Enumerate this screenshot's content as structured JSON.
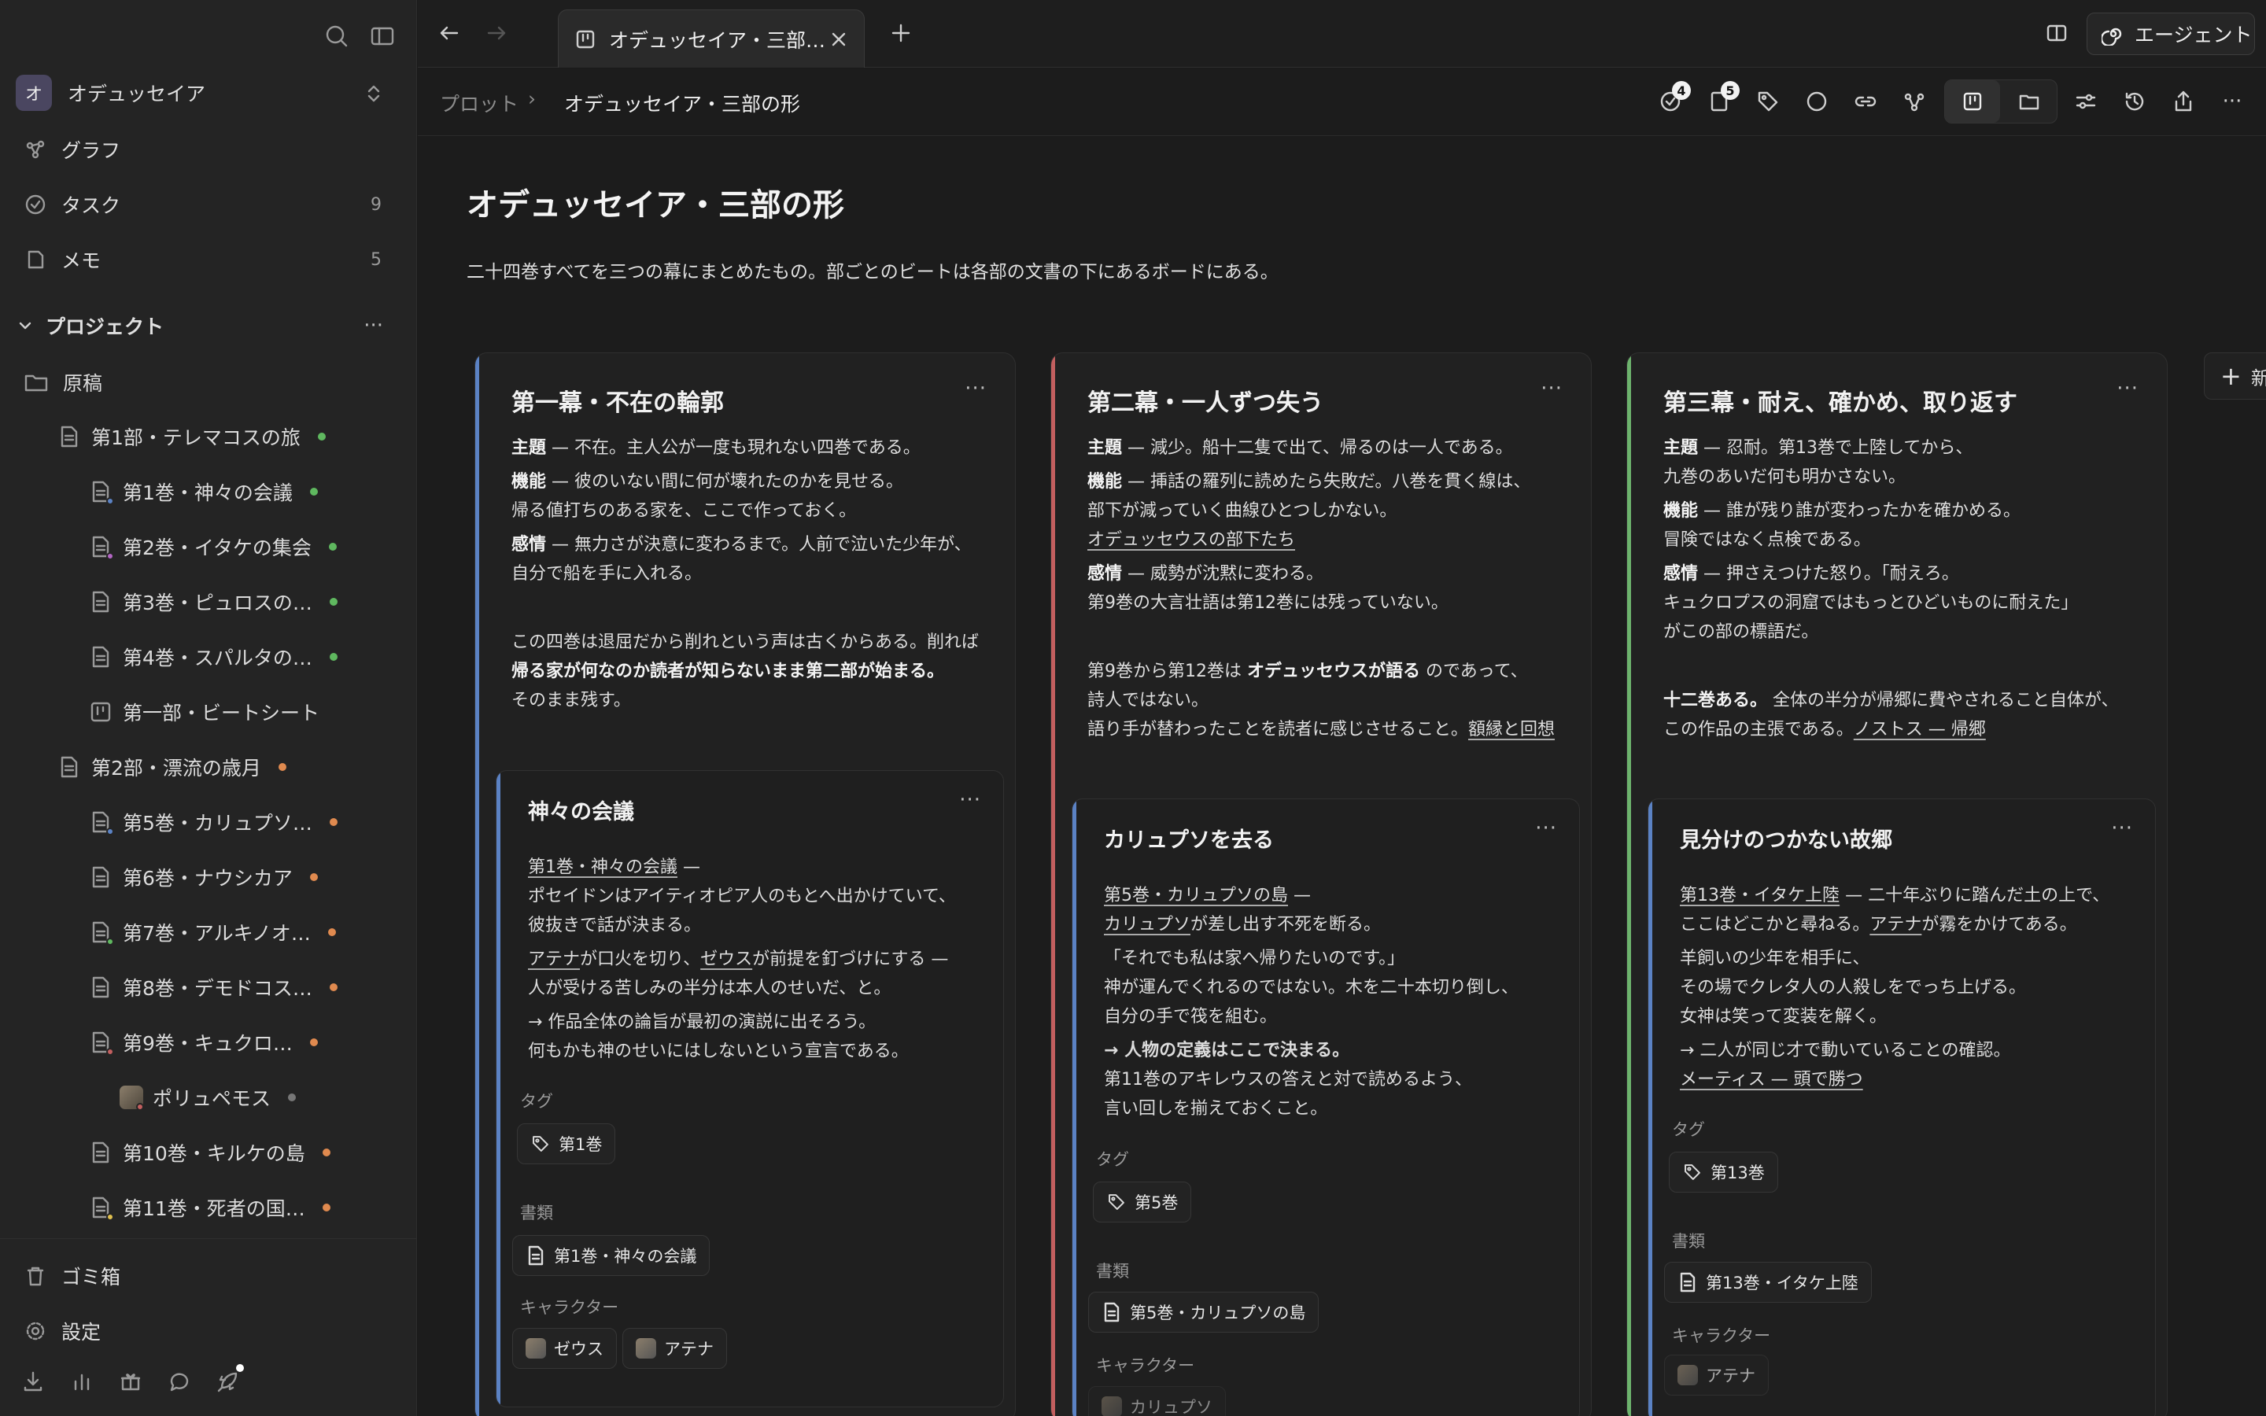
{
  "sidebar": {
    "workspace": {
      "initial": "オ",
      "name": "オデュッセイア"
    },
    "nav": [
      {
        "label": "グラフ",
        "count": ""
      },
      {
        "label": "タスク",
        "count": "9"
      },
      {
        "label": "メモ",
        "count": "5"
      }
    ],
    "projects_label": "プロジェクト",
    "tree": {
      "folder": "原稿",
      "items": [
        {
          "label": "第1部・テレマコスの旅"
        },
        {
          "label": "第1巻・神々の会議"
        },
        {
          "label": "第2巻・イタケの集会"
        },
        {
          "label": "第3巻・ピュロスの…"
        },
        {
          "label": "第4巻・スパルタの…"
        },
        {
          "label": "第一部・ビートシート"
        },
        {
          "label": "第2部・漂流の歳月"
        },
        {
          "label": "第5巻・カリュプソ…"
        },
        {
          "label": "第6巻・ナウシカア"
        },
        {
          "label": "第7巻・アルキノオ…"
        },
        {
          "label": "第8巻・デモドコス…"
        },
        {
          "label": "第9巻・キュクロ…"
        },
        {
          "label": "ポリュペモス"
        },
        {
          "label": "第10巻・キルケの島"
        },
        {
          "label": "第11巻・死者の国…"
        }
      ]
    },
    "trash": "ゴミ箱",
    "settings": "設定"
  },
  "topbar": {
    "tab_title": "オデュッセイア・三部の形",
    "agent_label": "エージェント"
  },
  "breadcrumb": {
    "parent": "プロット",
    "current": "オデュッセイア・三部の形"
  },
  "badges": {
    "tasks": "4",
    "docs": "5"
  },
  "page": {
    "title": "オデュッセイア・三部の形",
    "description": "二十四巻すべてを三つの幕にまとめたもの。部ごとのビートは各部の文書の下にあるボードにある。",
    "add_column_label": "新"
  },
  "colors": {
    "act1": "#5b82c4",
    "act2": "#c25f5f",
    "act3": "#6db36d"
  },
  "columns": [
    {
      "title": "第一幕・不在の輪郭",
      "l1": "主題",
      "l1t": " — 不在。主人公が一度も現れない四巻である。",
      "l2": "機能",
      "l2t": " — 彼のいない間に何が壊れたのかを見せる。",
      "l2b": "帰る値打ちのある家を、ここで作っておく。",
      "l3": "感情",
      "l3t": " — 無力さが決意に変わるまで。人前で泣いた少年が、",
      "l3b": "自分で船を手に入れる。",
      "p1": "この四巻は退屈だから削れという声は古くからある。削れば",
      "p2": "帰る家が何なのか読者が知らないまま第二部が始まる。",
      "p3": "そのまま残す。",
      "card": {
        "title": "神々の会議",
        "link1": "第1巻・神々の会議",
        "dash": " —",
        "t1": "ポセイドンはアイティオピア人のもとへ出かけていて、",
        "t2": "彼抜きで話が決まる。",
        "link2": "アテナ",
        "t3": "が口火を切り、",
        "link3": "ゼウス",
        "t4": "が前提を釘づけにする —",
        "t5": "人が受ける苦しみの半分は本人のせいだ、と。",
        "t6": "→ 作品全体の論旨が最初の演説に出そろう。",
        "t7": "何もかも神のせいにはしないという宣言である。",
        "tag_label": "タグ",
        "tag": "第1巻",
        "doc_label": "書類",
        "doc": "第1巻・神々の会議",
        "char_label": "キャラクター",
        "chars": [
          "ゼウス",
          "アテナ"
        ]
      }
    },
    {
      "title": "第二幕・一人ずつ失う",
      "l1": "主題",
      "l1t": " — 減少。船十二隻で出て、帰るのは一人である。",
      "l2": "機能",
      "l2t": " — 挿話の羅列に読めたら失敗だ。八巻を貫く線は、",
      "l2b": "部下が減っていく曲線ひとつしかない。",
      "l2c": "オデュッセウスの部下たち",
      "l3": "感情",
      "l3t": " — 威勢が沈黙に変わる。",
      "l3b": "第9巻の大言壮語は第12巻には残っていない。",
      "p1a": "第9巻から第12巻は ",
      "p1b": "オデュッセウスが語る",
      "p1c": " のであって、",
      "p2": "詩人ではない。",
      "p3": "語り手が替わったことを読者に感じさせること。",
      "p3link": "額縁と回想",
      "card": {
        "title": "カリュプソを去る",
        "link1": "第5巻・カリュプソの島",
        "dash": " —",
        "link2": "カリュプソ",
        "t1": "が差し出す不死を断る。",
        "t2": "「それでも私は家へ帰りたいのです。」",
        "t3": "神が運んでくれるのではない。木を二十本切り倒し、",
        "t4": "自分の手で筏を組む。",
        "t5": "→ 人物の定義はここで決まる。",
        "t6": "第11巻のアキレウスの答えと対で読めるよう、",
        "t7": "言い回しを揃えておくこと。",
        "tag_label": "タグ",
        "tag": "第5巻",
        "doc_label": "書類",
        "doc": "第5巻・カリュプソの島",
        "char_label": "キャラクター",
        "chars": [
          "カリュプソ"
        ]
      }
    },
    {
      "title": "第三幕・耐え、確かめ、取り返す",
      "l1": "主題",
      "l1t": " — 忍耐。第13巻で上陸してから、",
      "l1b": "九巻のあいだ何も明かさない。",
      "l2": "機能",
      "l2t": " — 誰が残り誰が変わったかを確かめる。",
      "l2b": "冒険ではなく点検である。",
      "l3": "感情",
      "l3t": " — 押さえつけた怒り。「耐えろ。",
      "l3b": "キュクロプスの洞窟ではもっとひどいものに耐えた」",
      "l3c": "がこの部の標語だ。",
      "p1a": "十二巻ある。",
      "p1b": " 全体の半分が帰郷に費やされること自体が、",
      "p2": "この作品の主張である。",
      "p2link": "ノストス — 帰郷",
      "card": {
        "title": "見分けのつかない故郷",
        "link1": "第13巻・イタケ上陸",
        "t1": " — 二十年ぶりに踏んだ土の上で、",
        "t2": "ここはどこかと尋ねる。",
        "link2": "アテナ",
        "t3": "が霧をかけてある。",
        "t4": "羊飼いの少年を相手に、",
        "t5": "その場でクレタ人の人殺しをでっち上げる。",
        "t6": "女神は笑って変装を解く。",
        "t7": "→ 二人が同じ才で動いていることの確認。",
        "link3": "メーティス — 頭で勝つ",
        "tag_label": "タグ",
        "tag": "第13巻",
        "doc_label": "書類",
        "doc": "第13巻・イタケ上陸",
        "char_label": "キャラクター",
        "chars": [
          "アテナ"
        ]
      }
    }
  ]
}
